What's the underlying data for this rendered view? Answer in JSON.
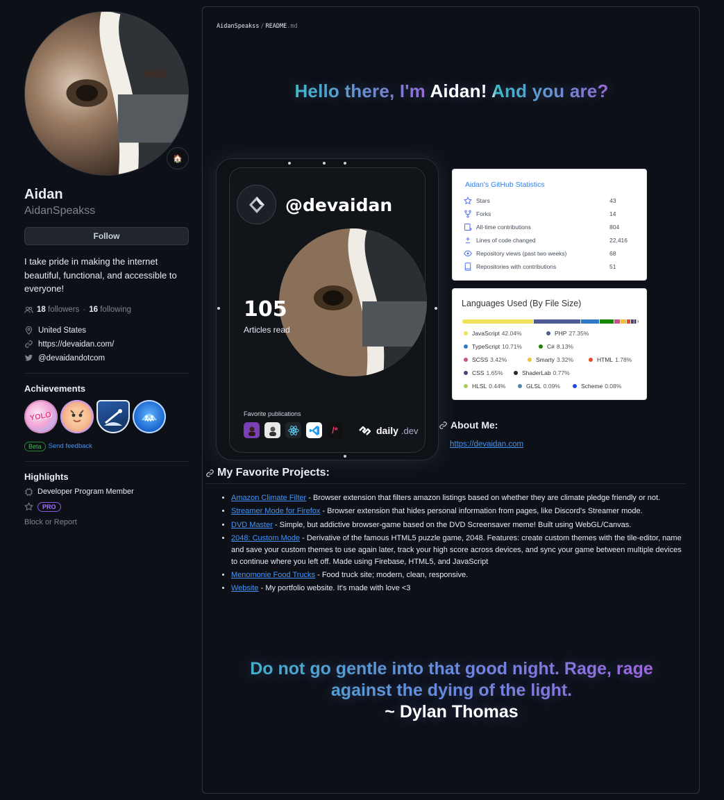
{
  "profile": {
    "name": "Aidan",
    "login": "AidanSpeakss",
    "follow_label": "Follow",
    "bio": "I take pride in making the internet beautiful, functional, and accessible to everyone!",
    "followers_count": "18",
    "followers_label": "followers",
    "separator": "·",
    "following_count": "16",
    "following_label": "following",
    "location": "United States",
    "website": "https://devaidan.com/",
    "twitter": "@devaidandotcom",
    "status_emoji": "🏠"
  },
  "achievements": {
    "title": "Achievements",
    "beta_label": "Beta",
    "feedback_label": "Send feedback",
    "badges": [
      {
        "name": "yolo-badge",
        "text": "YOLO",
        "color": "#f6a5d5"
      },
      {
        "name": "pull-shark-badge",
        "text": "",
        "color": "#f0c6a8"
      },
      {
        "name": "starstruck-badge",
        "text": "",
        "color": "#1f4a8a"
      },
      {
        "name": "shark-badge",
        "text": "",
        "color": "#2c6bd6"
      }
    ]
  },
  "highlights": {
    "title": "Highlights",
    "items": [
      "Developer Program Member"
    ],
    "pro_label": "PRO",
    "block_label": "Block or Report"
  },
  "readme": {
    "breadcrumb_user": "AidanSpeakss",
    "breadcrumb_sep": "/",
    "breadcrumb_file": "README",
    "breadcrumb_ext": ".md",
    "hello_parts": [
      "Hello there, I'm ",
      "Aidan",
      "! And you are?"
    ],
    "about_title": "About Me:",
    "about_link": "https://devaidan.com",
    "projects_title": "My Favorite Projects:",
    "projects": [
      {
        "title": "Amazon Climate Filter",
        "desc": " - Browser extension that filters amazon listings based on whether they are climate pledge friendly or not."
      },
      {
        "title": "Streamer Mode for Firefox",
        "desc": " - Browser extension that hides personal information from pages, like Discord's Streamer mode."
      },
      {
        "title": "DVD Master",
        "desc": " - Simple, but addictive browser-game based on the DVD Screensaver meme! Built using WebGL/Canvas."
      },
      {
        "title": "2048: Custom Mode",
        "desc": " - Derivative of the famous HTML5 puzzle game, 2048. Features: create custom themes with the tile-editor, name and save your custom themes to use again later, track your high score across devices, and sync your game between multiple devices to continue where you left off. Made using Firebase, HTML5, and JavaScript"
      },
      {
        "title": "Menomonie Food Trucks",
        "desc": " - Food truck site; modern, clean, responsive."
      },
      {
        "title": "Website",
        "desc": " - My portfolio website. It's made with love <3"
      }
    ],
    "quote_line1": "Do not go gentle into that good night. Rage, rage",
    "quote_line2": "against the dying of the light.",
    "quote_author": "~ Dylan Thomas"
  },
  "daily_card": {
    "handle": "@devaidan",
    "articles_count": "105",
    "articles_label": "Articles read",
    "favorites_label": "Favorite publications",
    "brand": "daily",
    "brand_suffix": ".dev"
  },
  "github_stats": {
    "title": "Aidan's GitHub Statistics",
    "rows": [
      {
        "icon": "star-icon",
        "label": "Stars",
        "value": "43"
      },
      {
        "icon": "fork-icon",
        "label": "Forks",
        "value": "14"
      },
      {
        "icon": "commit-icon",
        "label": "All-time contributions",
        "value": "804"
      },
      {
        "icon": "diff-icon",
        "label": "Lines of code changed",
        "value": "22,416"
      },
      {
        "icon": "eye-icon",
        "label": "Repository views (past two weeks)",
        "value": "68"
      },
      {
        "icon": "repo-icon",
        "label": "Repositories with contributions",
        "value": "51"
      }
    ]
  },
  "languages": {
    "title": "Languages Used (By File Size)",
    "items": [
      {
        "name": "JavaScript",
        "pct": "42.04%",
        "value": 42.04,
        "color": "#f1e05a"
      },
      {
        "name": "PHP",
        "pct": "27.35%",
        "value": 27.35,
        "color": "#4f5d95"
      },
      {
        "name": "TypeScript",
        "pct": "10.71%",
        "value": 10.71,
        "color": "#3178c6"
      },
      {
        "name": "C#",
        "pct": "8.13%",
        "value": 8.13,
        "color": "#178600"
      },
      {
        "name": "SCSS",
        "pct": "3.42%",
        "value": 3.42,
        "color": "#c6538c"
      },
      {
        "name": "Smarty",
        "pct": "3.32%",
        "value": 3.32,
        "color": "#f0c040"
      },
      {
        "name": "HTML",
        "pct": "1.78%",
        "value": 1.78,
        "color": "#e34c26"
      },
      {
        "name": "CSS",
        "pct": "1.65%",
        "value": 1.65,
        "color": "#563d7c"
      },
      {
        "name": "ShaderLab",
        "pct": "0.77%",
        "value": 0.77,
        "color": "#222c37"
      },
      {
        "name": "HLSL",
        "pct": "0.44%",
        "value": 0.44,
        "color": "#aace60"
      },
      {
        "name": "GLSL",
        "pct": "0.09%",
        "value": 0.09,
        "color": "#5686a5"
      },
      {
        "name": "Scheme",
        "pct": "0.08%",
        "value": 0.08,
        "color": "#1e4aec"
      }
    ]
  }
}
